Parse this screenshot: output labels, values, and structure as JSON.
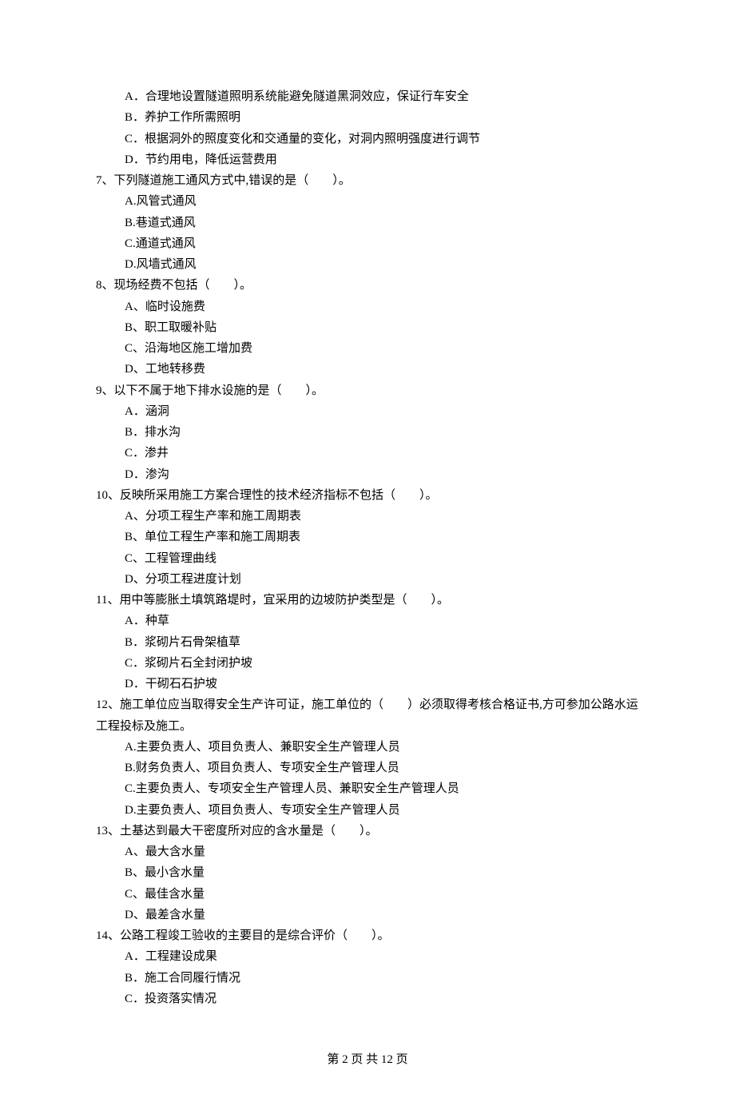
{
  "questions": [
    {
      "stem": "",
      "options": [
        "A．合理地设置隧道照明系统能避免隧道黑洞效应，保证行车安全",
        "B．养护工作所需照明",
        "C．根据洞外的照度变化和交通量的变化，对洞内照明强度进行调节",
        "D．节约用电，降低运营费用"
      ]
    },
    {
      "stem": "7、下列隧道施工通风方式中,错误的是（　　）。",
      "options": [
        "A.风管式通风",
        "B.巷道式通风",
        "C.通道式通风",
        "D.风墙式通风"
      ]
    },
    {
      "stem": "8、现场经费不包括（　　）。",
      "options": [
        "A、临时设施费",
        "B、职工取暖补贴",
        "C、沿海地区施工增加费",
        "D、工地转移费"
      ]
    },
    {
      "stem": "9、以下不属于地下排水设施的是（　　）。",
      "options": [
        "A．涵洞",
        "B．排水沟",
        "C．渗井",
        "D．渗沟"
      ]
    },
    {
      "stem": "10、反映所采用施工方案合理性的技术经济指标不包括（　　）。",
      "options": [
        "A、分项工程生产率和施工周期表",
        "B、单位工程生产率和施工周期表",
        "C、工程管理曲线",
        "D、分项工程进度计划"
      ]
    },
    {
      "stem": "11、用中等膨胀土填筑路堤时，宜采用的边坡防护类型是（　　）。",
      "options": [
        "A．种草",
        "B．浆砌片石骨架植草",
        "C．浆砌片石全封闭护坡",
        "D．干砌石石护坡"
      ]
    },
    {
      "stem": "12、施工单位应当取得安全生产许可证，施工单位的（　　）必须取得考核合格证书,方可参加公路水运工程投标及施工。",
      "options": [
        "A.主要负责人、项目负责人、兼职安全生产管理人员",
        "B.财务负责人、项目负责人、专项安全生产管理人员",
        "C.主要负责人、专项安全生产管理人员、兼职安全生产管理人员",
        "D.主要负责人、项目负责人、专项安全生产管理人员"
      ]
    },
    {
      "stem": "13、土基达到最大干密度所对应的含水量是（　　）。",
      "options": [
        "A、最大含水量",
        "B、最小含水量",
        "C、最佳含水量",
        "D、最差含水量"
      ]
    },
    {
      "stem": "14、公路工程竣工验收的主要目的是综合评价（　　）。",
      "options": [
        "A．工程建设成果",
        "B．施工合同履行情况",
        "C．投资落实情况"
      ]
    }
  ],
  "footer": "第 2 页 共 12 页"
}
